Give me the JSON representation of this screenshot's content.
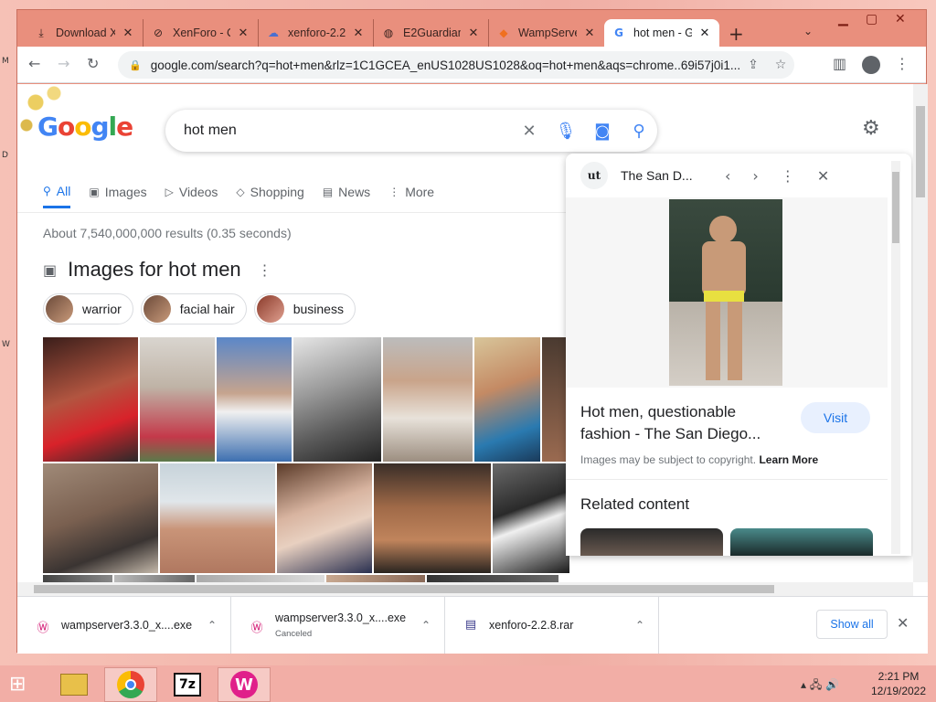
{
  "tabs": [
    {
      "label": "Download X",
      "icon": "download-icon"
    },
    {
      "label": "XenForo - C",
      "icon": "xenforo-icon"
    },
    {
      "label": "xenforo-2.2",
      "icon": "cloud-icon"
    },
    {
      "label": "E2Guardian",
      "icon": "globe-icon"
    },
    {
      "label": "WampServe",
      "icon": "wamp-icon"
    },
    {
      "label": "hot men - G",
      "icon": "google-icon"
    }
  ],
  "address": {
    "url": "google.com/search?q=hot+men&rlz=1C1GCEA_enUS1028US1028&oq=hot+men&aqs=chrome..69i57j0i1..."
  },
  "search": {
    "query": "hot men"
  },
  "nav": {
    "items": [
      "All",
      "Images",
      "Videos",
      "Shopping",
      "News",
      "More"
    ]
  },
  "results": {
    "stats": "About 7,540,000,000 results (0.35 seconds)"
  },
  "images_section": {
    "title": "Images for hot men"
  },
  "chips": [
    "warrior",
    "facial hair",
    "business"
  ],
  "panel": {
    "source": "The San D...",
    "title": "Hot men, questionable fashion - The San Diego...",
    "visit": "Visit",
    "copyright": "Images may be subject to copyright.",
    "learn_more": "Learn More",
    "related": "Related content"
  },
  "downloads": [
    {
      "name": "wampserver3.3.0_x....exe",
      "status": ""
    },
    {
      "name": "wampserver3.3.0_x....exe",
      "status": "Canceled"
    },
    {
      "name": "xenforo-2.2.8.rar",
      "status": ""
    }
  ],
  "download_bar": {
    "show_all": "Show all"
  },
  "taskbar": {
    "time": "2:21 PM",
    "date": "12/19/2022"
  },
  "colors": {
    "accent": "#1a73e8",
    "titlebar": "#e98f7d",
    "taskbar": "#f2aea6"
  }
}
